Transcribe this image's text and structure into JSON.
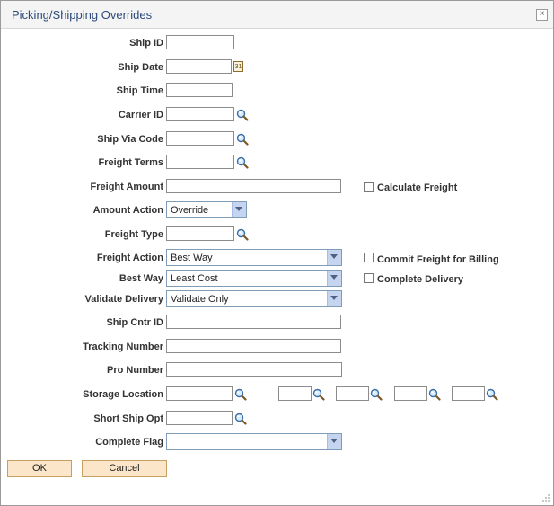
{
  "window": {
    "title": "Picking/Shipping Overrides",
    "close_glyph": "×"
  },
  "fields": {
    "ship_id": {
      "label": "Ship ID",
      "value": ""
    },
    "ship_date": {
      "label": "Ship Date",
      "value": "",
      "calendar_text": "31"
    },
    "ship_time": {
      "label": "Ship Time",
      "value": ""
    },
    "carrier_id": {
      "label": "Carrier ID",
      "value": ""
    },
    "ship_via_code": {
      "label": "Ship Via Code",
      "value": ""
    },
    "freight_terms": {
      "label": "Freight Terms",
      "value": ""
    },
    "freight_amount": {
      "label": "Freight Amount",
      "value": ""
    },
    "amount_action": {
      "label": "Amount Action",
      "value": "Override"
    },
    "freight_type": {
      "label": "Freight Type",
      "value": ""
    },
    "freight_action": {
      "label": "Freight Action",
      "value": "Best Way"
    },
    "best_way": {
      "label": "Best Way",
      "value": "Least Cost"
    },
    "validate_delivery": {
      "label": "Validate Delivery",
      "value": "Validate Only"
    },
    "ship_cntr_id": {
      "label": "Ship Cntr ID",
      "value": ""
    },
    "tracking_number": {
      "label": "Tracking Number",
      "value": ""
    },
    "pro_number": {
      "label": "Pro Number",
      "value": ""
    },
    "storage_location": {
      "label": "Storage Location",
      "values": [
        "",
        "",
        "",
        "",
        ""
      ]
    },
    "short_ship_opt": {
      "label": "Short Ship Opt",
      "value": ""
    },
    "complete_flag": {
      "label": "Complete Flag",
      "value": ""
    }
  },
  "checkboxes": {
    "calculate_freight": {
      "label": "Calculate Freight",
      "checked": false
    },
    "commit_freight": {
      "label": "Commit Freight for Billing",
      "checked": false
    },
    "complete_delivery": {
      "label": "Complete Delivery",
      "checked": false
    }
  },
  "buttons": {
    "ok": "OK",
    "cancel": "Cancel"
  },
  "icons": {
    "lookup": "magnifier-icon",
    "calendar": "calendar-icon"
  },
  "colors": {
    "title": "#2c4a7a",
    "button_bg": "#fbe6c9",
    "dropdown_arrow": "#c5d5f0"
  }
}
